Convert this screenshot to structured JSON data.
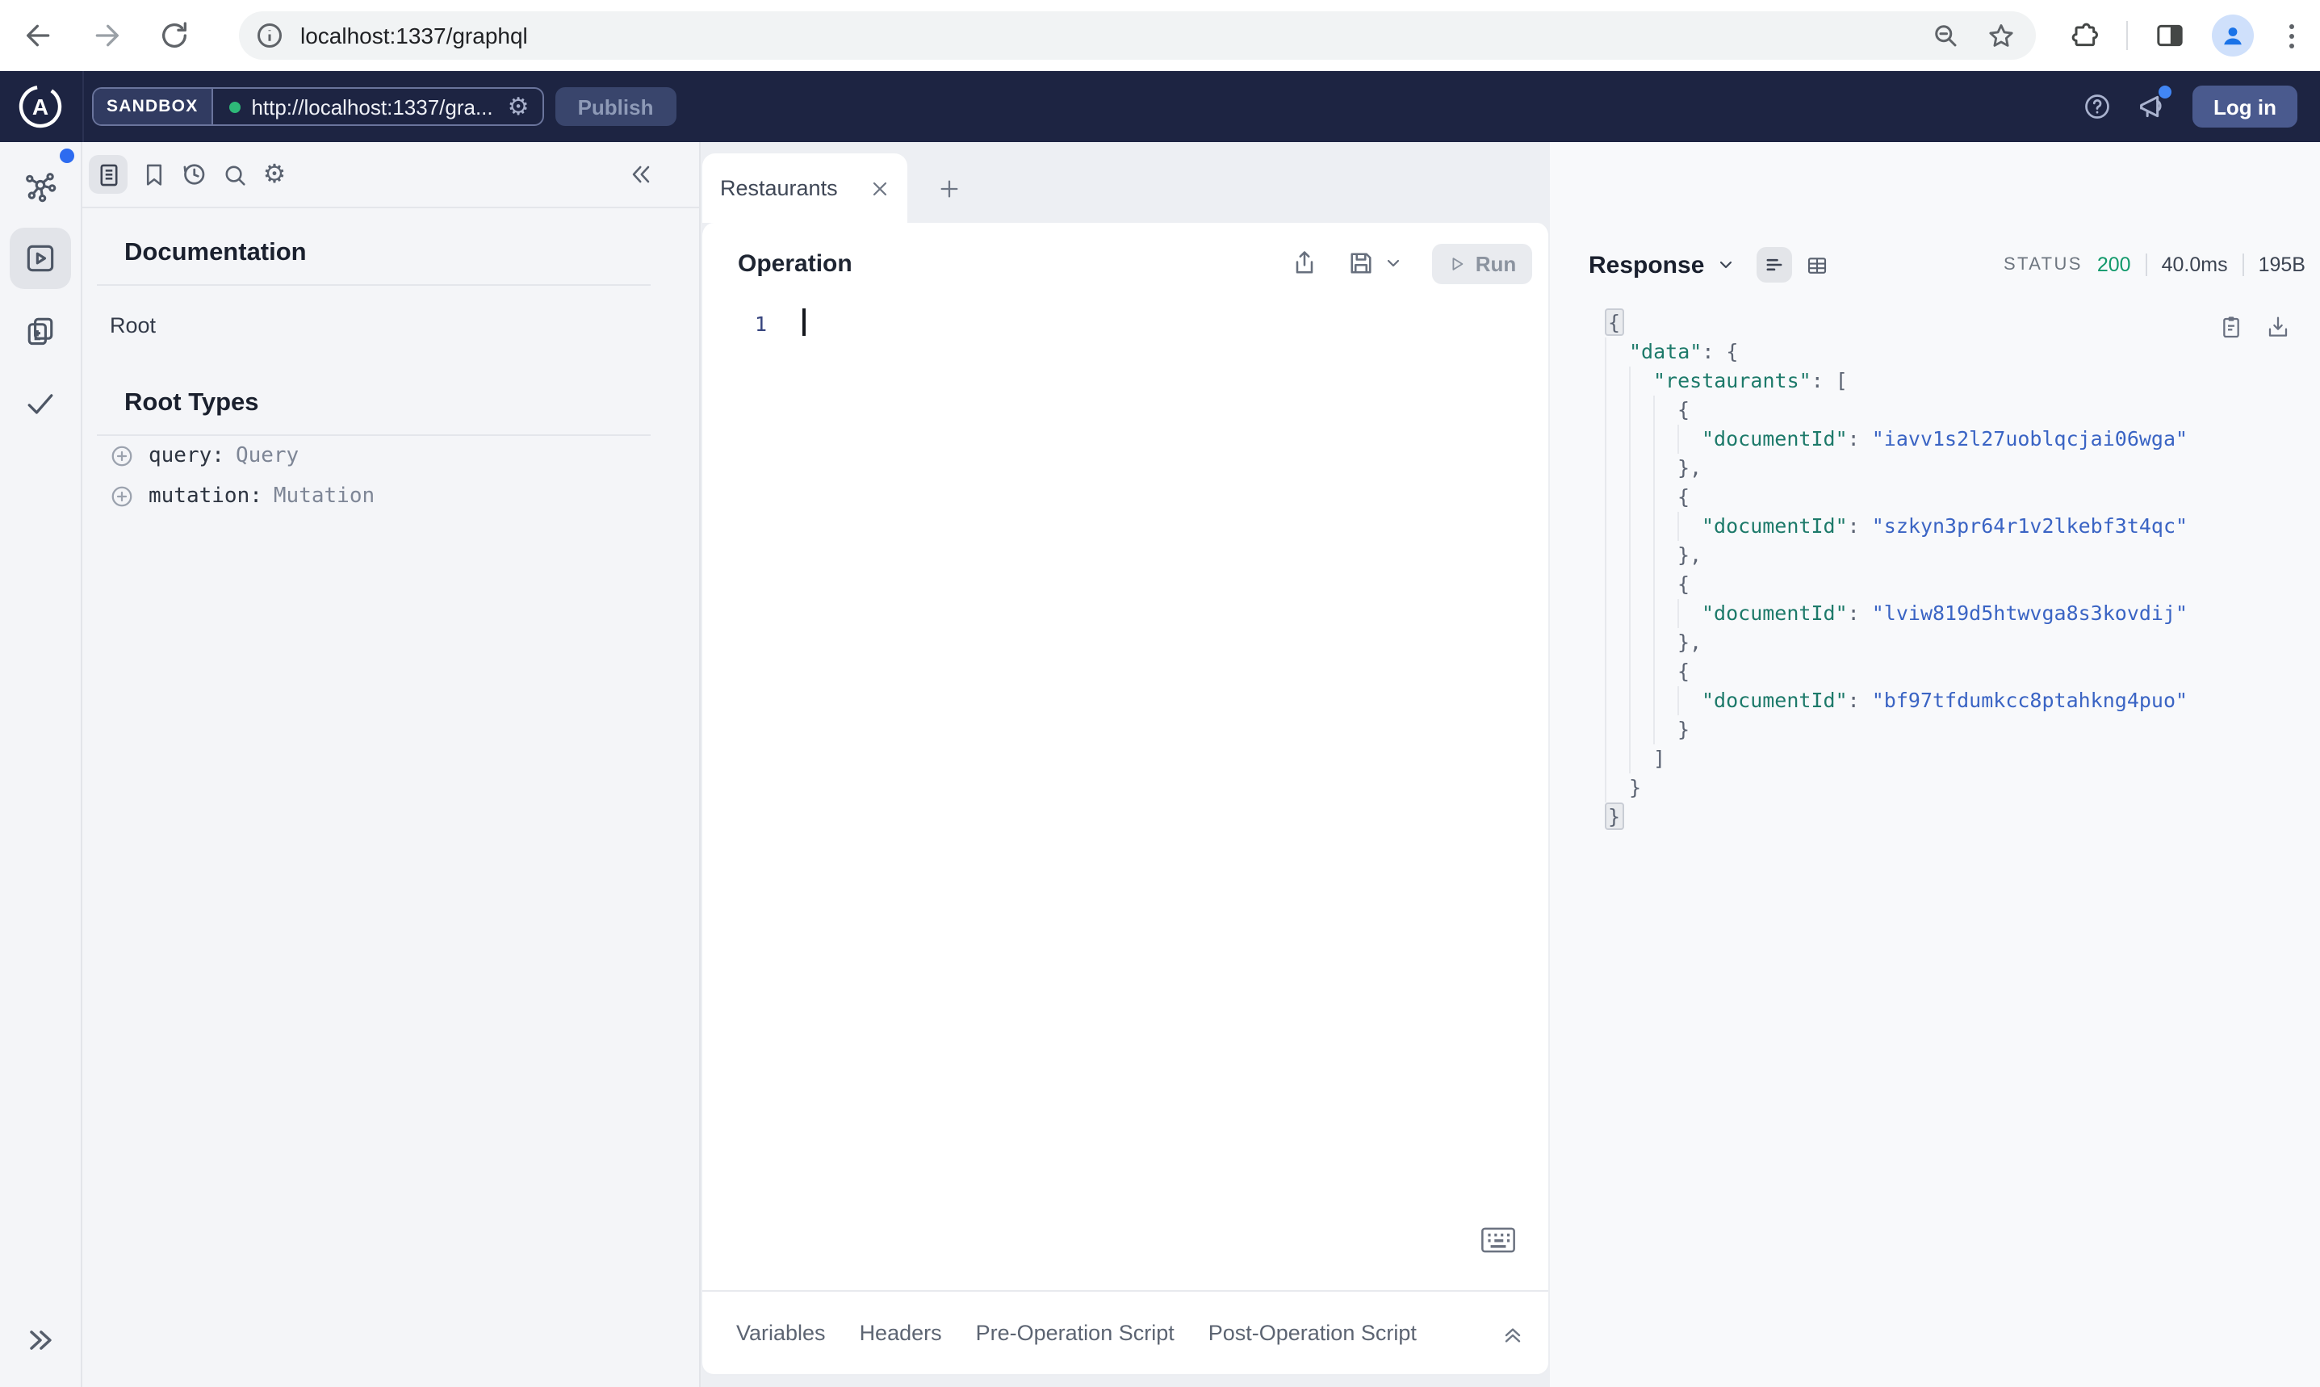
{
  "browser": {
    "url": "localhost:1337/graphql"
  },
  "header": {
    "logo_letter": "A",
    "env_label": "SANDBOX",
    "endpoint": "http://localhost:1337/gra...",
    "publish_label": "Publish",
    "login_label": "Log in"
  },
  "docs": {
    "title": "Documentation",
    "root_link": "Root",
    "section_title": "Root Types",
    "root_types": [
      {
        "field": "query:",
        "type": "Query"
      },
      {
        "field": "mutation:",
        "type": "Mutation"
      }
    ]
  },
  "tabs": {
    "active_label": "Restaurants"
  },
  "operation": {
    "title": "Operation",
    "run_label": "Run",
    "line_number": "1",
    "footer_tabs": [
      "Variables",
      "Headers",
      "Pre-Operation Script",
      "Post-Operation Script"
    ]
  },
  "response": {
    "title": "Response",
    "status_label": "STATUS",
    "status_code": "200",
    "time": "40.0ms",
    "size": "195B",
    "json_lines": [
      {
        "i": 0,
        "s": [
          [
            "b",
            "{"
          ]
        ]
      },
      {
        "i": 1,
        "s": [
          [
            "k",
            "\"data\""
          ],
          [
            "p",
            ": {"
          ]
        ]
      },
      {
        "i": 2,
        "s": [
          [
            "k",
            "\"restaurants\""
          ],
          [
            "p",
            ": ["
          ]
        ]
      },
      {
        "i": 3,
        "s": [
          [
            "p",
            "{"
          ]
        ]
      },
      {
        "i": 4,
        "s": [
          [
            "k",
            "\"documentId\""
          ],
          [
            "p",
            ": "
          ],
          [
            "v",
            "\"iavv1s2l27uoblqcjai06wga\""
          ]
        ]
      },
      {
        "i": 3,
        "s": [
          [
            "p",
            "},"
          ]
        ]
      },
      {
        "i": 3,
        "s": [
          [
            "p",
            "{"
          ]
        ]
      },
      {
        "i": 4,
        "s": [
          [
            "k",
            "\"documentId\""
          ],
          [
            "p",
            ": "
          ],
          [
            "v",
            "\"szkyn3pr64r1v2lkebf3t4qc\""
          ]
        ]
      },
      {
        "i": 3,
        "s": [
          [
            "p",
            "},"
          ]
        ]
      },
      {
        "i": 3,
        "s": [
          [
            "p",
            "{"
          ]
        ]
      },
      {
        "i": 4,
        "s": [
          [
            "k",
            "\"documentId\""
          ],
          [
            "p",
            ": "
          ],
          [
            "v",
            "\"lviw819d5htwvga8s3kovdij\""
          ]
        ]
      },
      {
        "i": 3,
        "s": [
          [
            "p",
            "},"
          ]
        ]
      },
      {
        "i": 3,
        "s": [
          [
            "p",
            "{"
          ]
        ]
      },
      {
        "i": 4,
        "s": [
          [
            "k",
            "\"documentId\""
          ],
          [
            "p",
            ": "
          ],
          [
            "v",
            "\"bf97tfdumkcc8ptahkng4puo\""
          ]
        ]
      },
      {
        "i": 3,
        "s": [
          [
            "p",
            "}"
          ]
        ]
      },
      {
        "i": 2,
        "s": [
          [
            "p",
            "]"
          ]
        ]
      },
      {
        "i": 1,
        "s": [
          [
            "p",
            "}"
          ]
        ]
      },
      {
        "i": 0,
        "s": [
          [
            "b",
            "}"
          ]
        ]
      }
    ]
  },
  "icons": {
    "gear_glyph": "⚙"
  },
  "colors": {
    "header_bg": "#1d2442",
    "status_green": "#12996b",
    "endpoint_dot_green": "#2eb878",
    "notification_blue": "#2d6bf0",
    "json_key": "#1d7a6a",
    "json_string": "#3a64c4"
  }
}
